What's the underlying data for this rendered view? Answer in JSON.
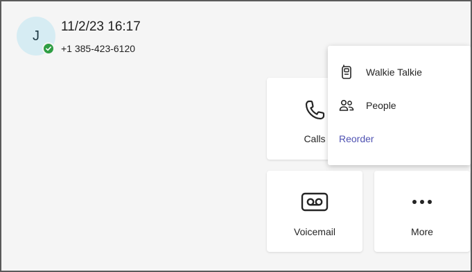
{
  "header": {
    "avatar_initial": "J",
    "title": "11/2/23 16:17",
    "phone_number": "+1 385-423-6120",
    "presence_status": "available"
  },
  "tiles": {
    "calls": {
      "label": "Calls",
      "icon": "phone-icon"
    },
    "voicemail": {
      "label": "Voicemail",
      "icon": "voicemail-icon"
    },
    "more": {
      "label": "More",
      "icon": "more-dots-icon"
    }
  },
  "menu": {
    "items": [
      {
        "label": "Walkie Talkie",
        "icon": "walkie-talkie-icon"
      },
      {
        "label": "People",
        "icon": "people-icon"
      }
    ],
    "reorder_label": "Reorder"
  },
  "colors": {
    "avatar_bg": "#d6ecf3",
    "presence_available": "#2f9e44",
    "accent_link": "#4f52b2",
    "background": "#f5f5f5"
  }
}
